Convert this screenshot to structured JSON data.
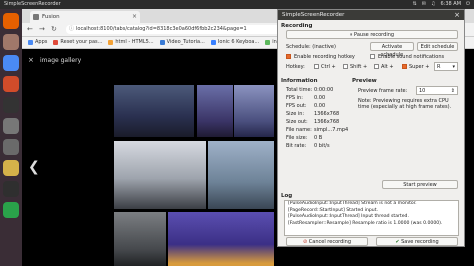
{
  "topbar": {
    "title": "SimpleScreenRecorder",
    "time": "6:38 AM",
    "tray": [
      "⇅",
      "✉",
      "♫",
      "⏻"
    ]
  },
  "launcher": [
    {
      "icon": "firefox-icon",
      "color": "#e66000"
    },
    {
      "icon": "files-icon",
      "color": "#a0786a"
    },
    {
      "icon": "chrome-icon",
      "color": "#4a8af4"
    },
    {
      "icon": "software-icon",
      "color": "#d14c2a"
    },
    {
      "icon": "amazon-icon",
      "color": "#333"
    },
    {
      "icon": "settings-icon",
      "color": "#777"
    },
    {
      "icon": "text-editor-icon",
      "color": "#6a6a6a"
    },
    {
      "icon": "folder-icon",
      "color": "#d4b24a"
    },
    {
      "icon": "terminal-icon",
      "color": "#2f2f2f"
    },
    {
      "icon": "screenshot-icon",
      "color": "#2aa24a"
    }
  ],
  "browser": {
    "tab_title": "Fusion",
    "url": "localhost:8100/tabs/catalog?id=8318c3e0a60df6fbb2c234&page=1",
    "bookmarks": [
      {
        "label": "Apps",
        "color": "#4a8af4"
      },
      {
        "label": "Reset your pas...",
        "color": "#e04a3a"
      },
      {
        "label": "html - HTML5...",
        "color": "#f4a236"
      },
      {
        "label": "Video_Tutoria...",
        "color": "#3a7bd5"
      },
      {
        "label": "Ionic 6 Keyboa...",
        "color": "#3880ff"
      },
      {
        "label": "install...",
        "color": "#5cb85c"
      }
    ]
  },
  "gallery": {
    "title": "image gallery",
    "close": "×",
    "prev": "❮",
    "next": "❯"
  },
  "ssr": {
    "title": "SimpleScreenRecorder",
    "close": "×",
    "recording_header": "Recording",
    "pause_recording": "Pause recording",
    "schedule_label": "Schedule: (inactive)",
    "activate_schedule": "Activate schedule",
    "edit_schedule": "Edit schedule",
    "enable_hotkey": "Enable recording hotkey",
    "enable_sound": "Enable sound notifications",
    "hotkey_label": "Hotkey:",
    "ctrl": "Ctrl +",
    "shift": "Shift +",
    "alt": "Alt +",
    "super": "Super +",
    "key": "R",
    "info_header": "Information",
    "info": [
      {
        "k": "Total time:",
        "v": "0:00:00"
      },
      {
        "k": "FPS in:",
        "v": "0.00"
      },
      {
        "k": "FPS out:",
        "v": "0.00"
      },
      {
        "k": "Size in:",
        "v": "1366x768"
      },
      {
        "k": "Size out:",
        "v": "1366x768"
      },
      {
        "k": "File name:",
        "v": "simpl...7.mp4"
      },
      {
        "k": "File size:",
        "v": "0 B"
      },
      {
        "k": "Bit rate:",
        "v": "0 bit/s"
      }
    ],
    "preview_header": "Preview",
    "preview_rate_label": "Preview frame rate:",
    "preview_rate": "10",
    "preview_note": "Note: Previewing requires extra CPU time (especially at high frame rates).",
    "start_preview": "Start preview",
    "log_header": "Log",
    "log": [
      "[PulseAudioInput::InputThread] Stream is not a monitor.",
      "[PageRecord::StartInput] Started input.",
      "[PulseAudioInput::InputThread] Input thread started.",
      "[FastResampler::Resample] Resample ratio is 1.0000 (was 0.0000)."
    ],
    "cancel_recording": "Cancel recording",
    "save_recording": "Save recording",
    "accent": "#e76a2c"
  }
}
